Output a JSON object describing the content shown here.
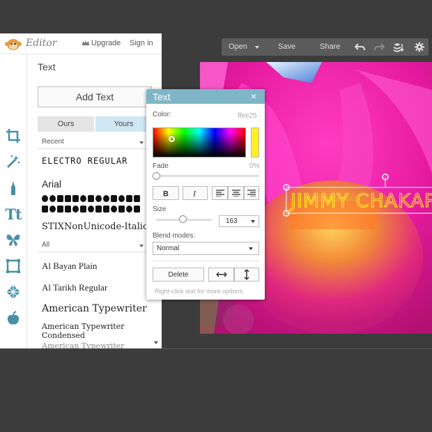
{
  "app": {
    "name": "Editor",
    "upgrade_label": "Upgrade",
    "signin_label": "Sign in"
  },
  "toolbar": {
    "open_label": "Open",
    "save_label": "Save",
    "share_label": "Share",
    "icons": [
      "undo-icon",
      "redo-icon",
      "layers-icon",
      "settings-icon"
    ]
  },
  "tools": [
    "crop-icon",
    "magic-wand-icon",
    "brush-icon",
    "text-tool-icon",
    "butterfly-icon",
    "frame-icon",
    "texture-icon",
    "apple-icon"
  ],
  "text_tool": {
    "glyph": "Tt"
  },
  "panel": {
    "title": "Text",
    "add_text_label": "Add Text",
    "tab_ours": "Ours",
    "tab_yours": "Yours",
    "recent_label": "Recent",
    "all_label": "All",
    "recent_fonts": [
      "ELECTRO REGULAR",
      "Arial",
      "STIXNonUnicode-Italic"
    ],
    "all_fonts": [
      "Al Bayan Plain",
      "Al Tarikh Regular",
      "American Typewriter",
      "American Typewriter Condensed",
      "American Typewriter"
    ]
  },
  "dialog": {
    "title": "Text",
    "close": "×",
    "color_label": "Color:",
    "color_value": "ffee25",
    "fade_label": "Fade",
    "fade_value": "0%",
    "fade_percent": 0,
    "size_label": "Size",
    "size_value": "163",
    "blend_label": "Blend modes:",
    "blend_value": "Normal",
    "delete_label": "Delete",
    "hint": "Right-click text for more options.",
    "swatch_color": "#ffee25"
  },
  "canvas": {
    "text": "JIMMY CHAKAR",
    "text_color": "#ffee25"
  },
  "colors": {
    "accent": "#7fb6c7",
    "text_tool_blue": "#4a8fa8",
    "tab_active": "#cfe7f2"
  }
}
